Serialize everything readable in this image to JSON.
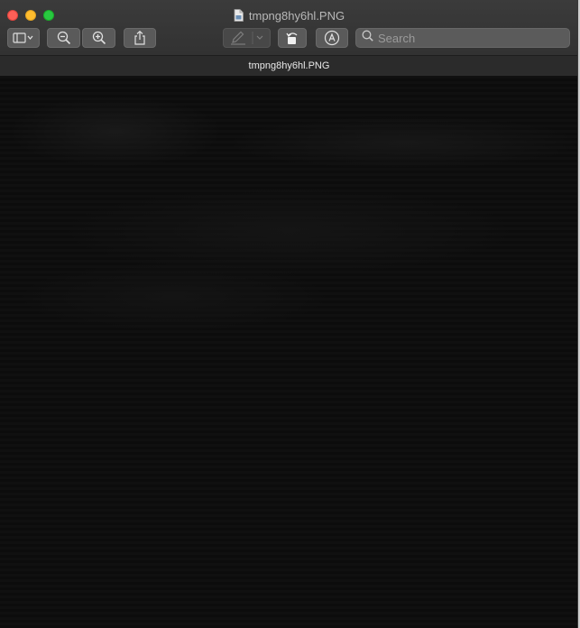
{
  "window": {
    "title": "tmpng8hy6hl.PNG"
  },
  "toolbar": {
    "sidebar_button": "sidebar-icon",
    "zoom_out_button": "zoom-out-icon",
    "zoom_in_button": "zoom-in-icon",
    "share_button": "share-icon",
    "markup_button": "pen-icon",
    "rotate_button": "rotate-icon",
    "annotate_button": "markup-icon"
  },
  "search": {
    "placeholder": "Search"
  },
  "document": {
    "title": "tmpng8hy6hl.PNG"
  },
  "colors": {
    "close": "#fe5f57",
    "minimize": "#febc2e",
    "maximize": "#28c840"
  }
}
